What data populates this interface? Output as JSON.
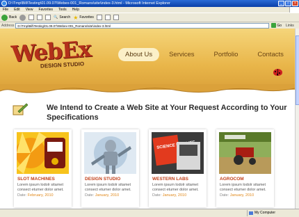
{
  "window": {
    "title": "D:\\Tmp\\Bill\\Testing\\01.09.07\\Webex-001_Romans\\site\\index-3.html - Microsoft Internet Explorer"
  },
  "menu": [
    "File",
    "Edit",
    "View",
    "Favorites",
    "Tools",
    "Help"
  ],
  "toolbar": {
    "back": "Back",
    "search": "Search",
    "favorites": "Favorites"
  },
  "address": {
    "label": "Address",
    "value": "D:\\Tmp\\Bill\\Testing\\01.09.07\\Webex-001_Romans\\site\\index-3.html",
    "go": "Go",
    "links": "Links"
  },
  "site": {
    "logo": "WebEx",
    "logo_sub": "DESIGN STUDIO",
    "nav": [
      "About Us",
      "Services",
      "Portfolio",
      "Contacts"
    ],
    "intro": "We Intend to Create a Web Site at Your Request According to Your Specifications"
  },
  "cards": [
    {
      "title": "SLOT MACHINES",
      "desc": "Lorem ipsum lodolr sitamet consect etumer dolor amet.",
      "date_label": "Date:",
      "date": "February, 2010"
    },
    {
      "title": "DESIGN STUDIO",
      "desc": "Lorem ipsum lodolr sitamet consect etumer dolor amet.",
      "date_label": "Date:",
      "date": "January, 2010"
    },
    {
      "title": "WESTERN LABS",
      "desc": "Lorem ipsum lodolr sitamet consect etumer dolor amet.",
      "date_label": "Date:",
      "date": "January, 2010"
    },
    {
      "title": "AGROCOM",
      "desc": "Lorem ipsum lodolr sitamet consect etumer dolor amet.",
      "date_label": "Date:",
      "date": "January, 2010"
    }
  ],
  "card_images": {
    "science_text": "SCIENCE FOR LIFE"
  },
  "status": {
    "zone": "My Computer"
  },
  "colors": {
    "accent": "#c2401a",
    "date": "#e0881a",
    "header": "#e9b64a"
  }
}
